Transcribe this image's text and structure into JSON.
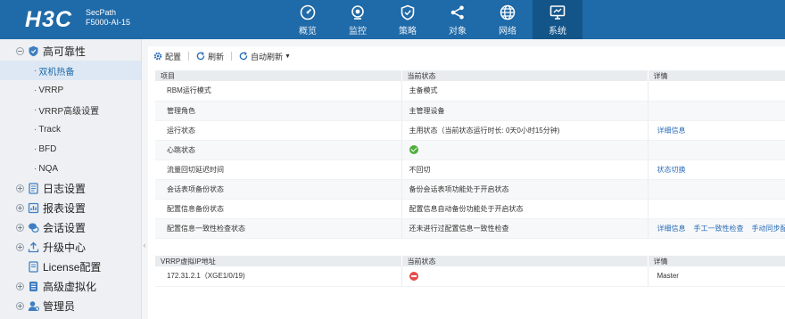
{
  "brand": {
    "logo": "H3C",
    "product_line1": "SecPath",
    "product_line2": "F5000-AI-15"
  },
  "nav": [
    {
      "label": "概览",
      "icon": "gauge-icon"
    },
    {
      "label": "监控",
      "icon": "camera-icon"
    },
    {
      "label": "策略",
      "icon": "shield-icon"
    },
    {
      "label": "对象",
      "icon": "share-icon"
    },
    {
      "label": "网络",
      "icon": "globe-icon"
    },
    {
      "label": "系统",
      "icon": "monitor-icon",
      "active": true
    }
  ],
  "sidebar": {
    "group_ha": {
      "label": "高可靠性",
      "icon": "shield-icon"
    },
    "sub_items": [
      "双机热备",
      "VRRP",
      "VRRP高级设置",
      "Track",
      "BFD",
      "NQA"
    ],
    "active_sub": "双机热备",
    "groups": [
      {
        "label": "日志设置",
        "icon": "log-icon"
      },
      {
        "label": "报表设置",
        "icon": "report-icon"
      },
      {
        "label": "会话设置",
        "icon": "session-icon"
      },
      {
        "label": "升级中心",
        "icon": "upload-icon"
      },
      {
        "label": "License配置",
        "icon": "license-icon"
      },
      {
        "label": "高级虚拟化",
        "icon": "virtualization-icon"
      },
      {
        "label": "管理员",
        "icon": "admin-icon"
      }
    ]
  },
  "toolbar": {
    "config": "配置",
    "refresh": "刷新",
    "auto_refresh": "自动刷新"
  },
  "table1": {
    "headers": [
      "项目",
      "当前状态",
      "详情"
    ],
    "rows": [
      {
        "item": "RBM运行模式",
        "status": "主备模式",
        "details": []
      },
      {
        "item": "管理角色",
        "status": "主管理设备",
        "details": []
      },
      {
        "item": "运行状态",
        "status": "主用状态（当前状态运行时长: 0天0小时15分钟)",
        "details": [
          "详细信息"
        ]
      },
      {
        "item": "心跳状态",
        "status": "",
        "status_icon": "ok",
        "details": []
      },
      {
        "item": "流量回切延迟时间",
        "status": "不回切",
        "details": [
          "状态切换"
        ]
      },
      {
        "item": "会话表项备份状态",
        "status": "备份会话表项功能处于开启状态",
        "details": []
      },
      {
        "item": "配置信息备份状态",
        "status": "配置信息自动备份功能处于开启状态",
        "details": []
      },
      {
        "item": "配置信息一致性检查状态",
        "status": "还未进行过配置信息一致性检查",
        "details": [
          "详细信息",
          "手工一致性检查",
          "手动同步配"
        ]
      }
    ]
  },
  "table2": {
    "headers": [
      "VRRP虚拟IP地址",
      "当前状态",
      "详情"
    ],
    "rows": [
      {
        "ip": "172.31.2.1（XGE1/0/19)",
        "status_icon": "error",
        "detail": "Master"
      }
    ]
  },
  "colors": {
    "header": "#1f6aa8",
    "header_active": "#145589",
    "link": "#2a6cb8",
    "ok": "#4fae3b",
    "error": "#e84b4b"
  }
}
